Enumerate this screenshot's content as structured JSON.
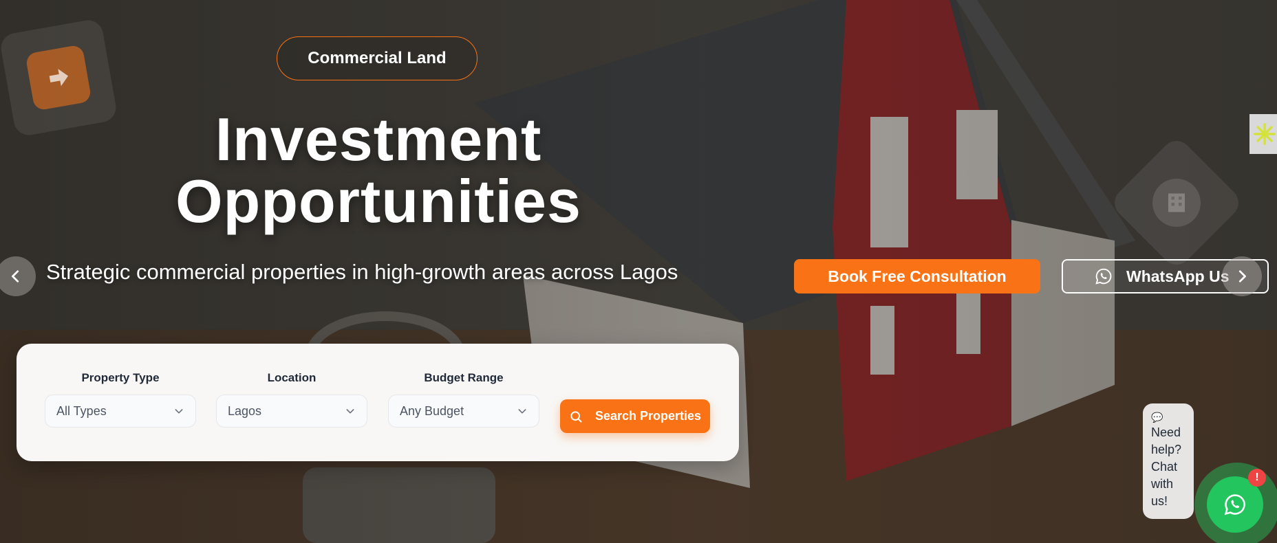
{
  "hero": {
    "badge": "Commercial Land",
    "headline_line1": "Investment",
    "headline_line2": "Opportunities",
    "subtitle": "Strategic commercial properties in high-growth areas across Lagos",
    "primary_cta": "Book Free Consultation",
    "secondary_cta": "WhatsApp Us"
  },
  "search": {
    "property_type": {
      "label": "Property Type",
      "value": "All Types"
    },
    "location": {
      "label": "Location",
      "value": "Lagos"
    },
    "budget": {
      "label": "Budget Range",
      "value": "Any Budget"
    },
    "button": "Search Properties"
  },
  "chat": {
    "emoji": "💬",
    "message": "Need help? Chat with us!",
    "badge": "!"
  },
  "icons": {
    "prev": "chevron-left-icon",
    "next": "chevron-right-icon",
    "whatsapp": "whatsapp-icon",
    "search": "search-icon",
    "dropdown": "chevron-down-icon"
  },
  "colors": {
    "accent": "#f97316",
    "whatsapp": "#22c55e",
    "notification": "#ef4444"
  }
}
